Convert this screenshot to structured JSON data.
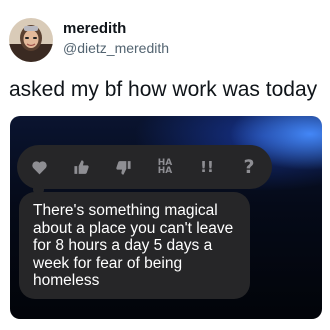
{
  "tweet": {
    "author_name": "meredith",
    "author_handle": "@dietz_meredith",
    "text": "asked my bf how work was today"
  },
  "screenshot": {
    "reactions": [
      {
        "icon": "heart-icon"
      },
      {
        "icon": "thumbs-up-icon"
      },
      {
        "icon": "thumbs-down-icon"
      },
      {
        "icon": "haha-icon",
        "label": "HA HA"
      },
      {
        "icon": "exclamation-icon",
        "label": "!!"
      },
      {
        "icon": "question-icon",
        "label": "?"
      }
    ],
    "message": "There's something magical about a place you can't leave for 8 hours a day 5 days a week for fear of being homeless"
  },
  "colors": {
    "bubble": "#262628",
    "icon": "#8e8e93",
    "handle": "#536471"
  }
}
